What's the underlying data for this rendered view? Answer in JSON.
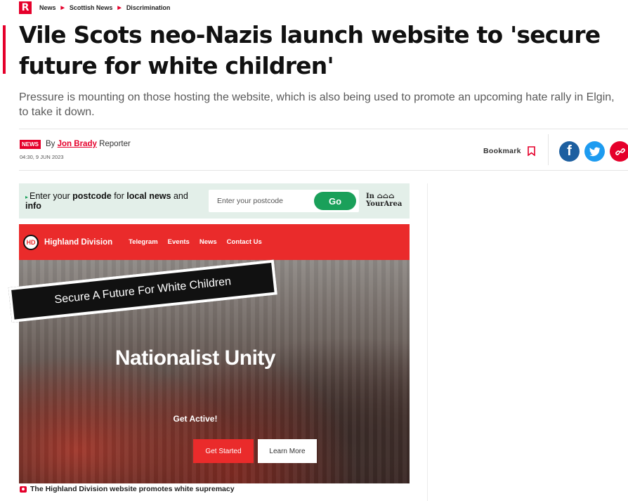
{
  "breadcrumb": {
    "logo": "R",
    "items": [
      "News",
      "Scottish News",
      "Discrimination"
    ]
  },
  "article": {
    "title": "Vile Scots neo-Nazis launch website to 'secure future for white children'",
    "standfirst": "Pressure is mounting on those hosting the website, which is also being used to promote an upcoming hate rally in Elgin, to take it down.",
    "badge": "NEWS",
    "by": "By",
    "author": "Jon Brady",
    "role": "Reporter",
    "date": "04:30, 9 JUN 2023",
    "bookmark_label": "Bookmark"
  },
  "share": {
    "facebook_icon": "f",
    "twitter_icon": "twitter-bird",
    "link_icon": "link"
  },
  "postcode": {
    "lead": "Enter your ",
    "postcode_bold": "postcode",
    "mid": " for ",
    "local_bold": "local news",
    "tail": " and ",
    "info_bold": "info",
    "placeholder": "Enter your postcode",
    "go": "Go",
    "brand_line1": "In",
    "brand_line2": "YourArea"
  },
  "hero": {
    "site_logo": "HD",
    "site_name": "Highland Division",
    "nav": [
      "Telegram",
      "Events",
      "News",
      "Contact Us"
    ],
    "banner": "Secure A Future For White Children",
    "headline": "Nationalist Unity",
    "cta_text": "Get Active!",
    "btn_start": "Get Started",
    "btn_learn": "Learn More"
  },
  "caption": "The Highland Division website promotes white supremacy",
  "colors": {
    "brand_red": "#e5002b",
    "facebook": "#1d5fa0",
    "twitter": "#1d9bf0",
    "go_green": "#1aa05a",
    "postcode_bg": "#e3efe9"
  }
}
